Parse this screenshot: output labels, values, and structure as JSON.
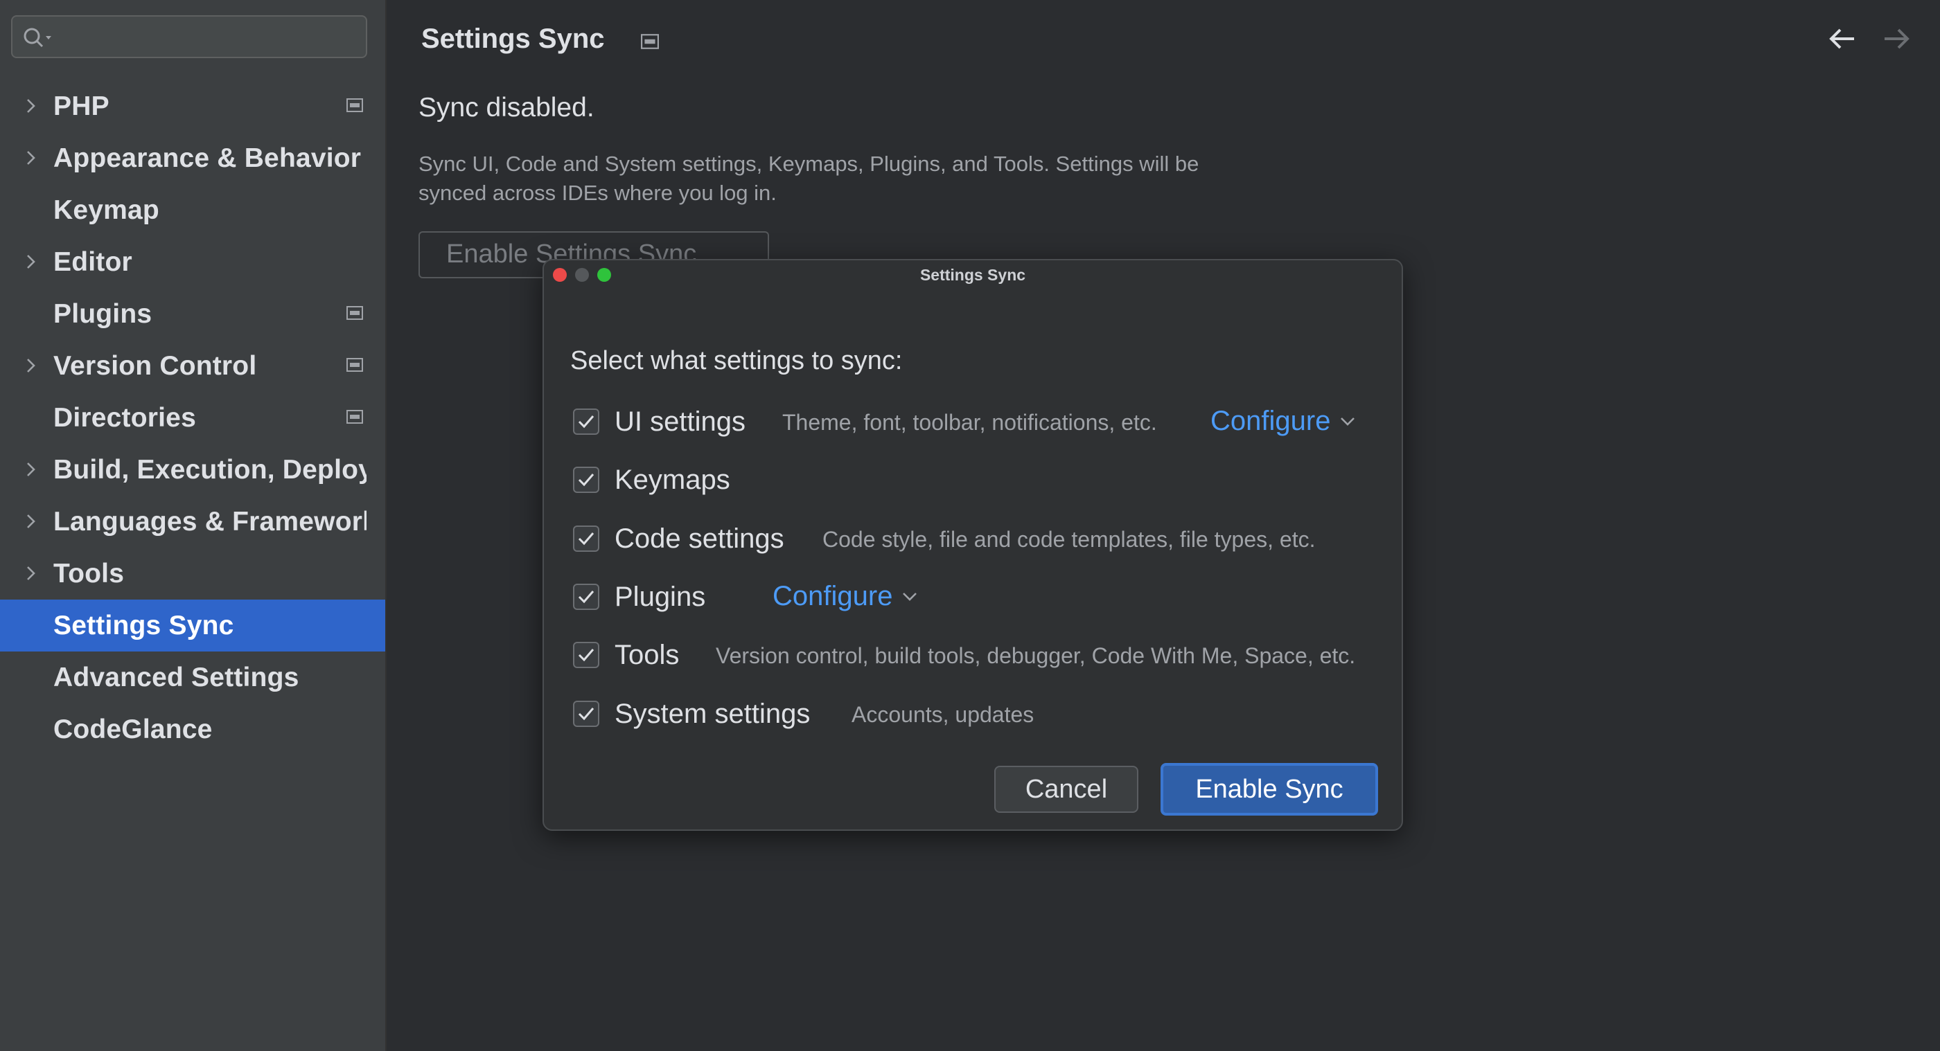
{
  "sidebar": {
    "search": {
      "placeholder": ""
    },
    "items": [
      {
        "label": "PHP",
        "expandable": true,
        "project_icon": true,
        "selected": false
      },
      {
        "label": "Appearance & Behavior",
        "expandable": true,
        "project_icon": false,
        "selected": false
      },
      {
        "label": "Keymap",
        "expandable": false,
        "project_icon": false,
        "selected": false
      },
      {
        "label": "Editor",
        "expandable": true,
        "project_icon": false,
        "selected": false
      },
      {
        "label": "Plugins",
        "expandable": false,
        "project_icon": true,
        "selected": false
      },
      {
        "label": "Version Control",
        "expandable": true,
        "project_icon": true,
        "selected": false
      },
      {
        "label": "Directories",
        "expandable": false,
        "project_icon": true,
        "selected": false
      },
      {
        "label": "Build, Execution, Deployment",
        "expandable": true,
        "project_icon": false,
        "selected": false
      },
      {
        "label": "Languages & Frameworks",
        "expandable": true,
        "project_icon": false,
        "selected": false
      },
      {
        "label": "Tools",
        "expandable": true,
        "project_icon": false,
        "selected": false
      },
      {
        "label": "Settings Sync",
        "expandable": false,
        "project_icon": false,
        "selected": true
      },
      {
        "label": "Advanced Settings",
        "expandable": false,
        "project_icon": false,
        "selected": false
      },
      {
        "label": "CodeGlance",
        "expandable": false,
        "project_icon": false,
        "selected": false
      }
    ]
  },
  "main": {
    "title": "Settings Sync",
    "status": "Sync disabled.",
    "description_line1": "Sync UI, Code and System settings, Keymaps, Plugins, and Tools. Settings will be",
    "description_line2": "synced across IDEs where you log in.",
    "enable_button_label": "Enable Settings Sync..."
  },
  "dialog": {
    "title": "Settings Sync",
    "prompt": "Select what settings to sync:",
    "options": [
      {
        "label": "UI settings",
        "description": "Theme, font, toolbar, notifications, etc.",
        "checked": true,
        "configure": "Configure"
      },
      {
        "label": "Keymaps",
        "description": "",
        "checked": true,
        "configure": ""
      },
      {
        "label": "Code settings",
        "description": "Code style, file and code templates, file types, etc.",
        "checked": true,
        "configure": ""
      },
      {
        "label": "Plugins",
        "description": "",
        "checked": true,
        "configure": "Configure"
      },
      {
        "label": "Tools",
        "description": "Version control, build tools, debugger, Code With Me, Space, etc.",
        "checked": true,
        "configure": ""
      },
      {
        "label": "System settings",
        "description": "Accounts, updates",
        "checked": true,
        "configure": ""
      }
    ],
    "cancel_label": "Cancel",
    "confirm_label": "Enable Sync"
  },
  "colors": {
    "accent": "#2f65ca",
    "link": "#4d9bf6",
    "background": "#2b2d30",
    "sidebar": "#3c3f41"
  },
  "icons": {
    "search": "search-icon",
    "expand": "chevron-right-icon",
    "project": "project-level-icon",
    "back": "arrow-left-icon",
    "forward": "arrow-right-icon",
    "check": "checkmark-icon",
    "dropdown": "chevron-down-icon"
  }
}
